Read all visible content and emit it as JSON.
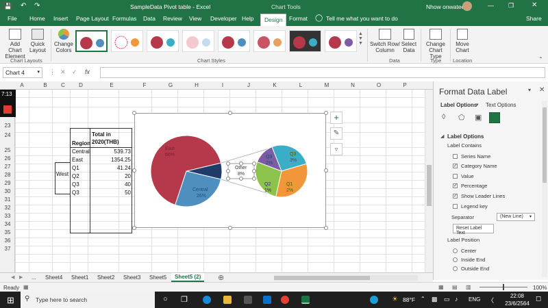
{
  "title_bar": {
    "title": "SampleData Pivot table  -  Excel",
    "context_tab": "Chart Tools",
    "user": "Nhow onwatee",
    "autosave_icon": "save-icon",
    "undo_icon": "undo-icon",
    "redo_icon": "redo-icon"
  },
  "tabs": [
    {
      "label": "File"
    },
    {
      "label": "Home"
    },
    {
      "label": "Insert"
    },
    {
      "label": "Page Layout"
    },
    {
      "label": "Formulas"
    },
    {
      "label": "Data"
    },
    {
      "label": "Review"
    },
    {
      "label": "View"
    },
    {
      "label": "Developer"
    },
    {
      "label": "Help"
    },
    {
      "label": "Design"
    },
    {
      "label": "Format"
    }
  ],
  "tell_me": "Tell me what you want to do",
  "share": "Share",
  "ribbon": {
    "add_chart_element": "Add Chart Element",
    "quick_layout": "Quick Layout",
    "change_colors": "Change Colors",
    "chart_layouts": "Chart Layouts",
    "chart_styles": "Chart Styles",
    "switch_row_column": "Switch Row/ Column",
    "select_data": "Select Data",
    "data_group": "Data",
    "change_chart_type": "Change Chart Type",
    "type_group": "Type",
    "move_chart": "Move Chart",
    "location_group": "Location"
  },
  "name_box": "Chart 4",
  "fx": "fx",
  "columns": [
    "A",
    "B",
    "C",
    "D",
    "E",
    "F",
    "G",
    "H",
    "I",
    "J",
    "K",
    "L",
    "M",
    "N",
    "O",
    "P"
  ],
  "rows": [
    "20",
    "21",
    "22",
    "23",
    "24",
    "25",
    "26",
    "27",
    "28",
    "29",
    "30",
    "31",
    "32",
    "33",
    "34",
    "35",
    "36",
    "37"
  ],
  "timer": "7:13",
  "table": {
    "header_region": "Region",
    "header_total": "Total in 2020(THB)",
    "group_label": "West",
    "rows": [
      {
        "region": "Central",
        "value": "539.73"
      },
      {
        "region": "East",
        "value": "1354.25"
      },
      {
        "region": "Q1",
        "value": "41.24"
      },
      {
        "region": "Q2",
        "value": "20"
      },
      {
        "region": "Q3",
        "value": "40"
      },
      {
        "region": "Q3",
        "value": "50"
      }
    ]
  },
  "chart_data": {
    "type": "pie",
    "subtype": "pie-of-pie",
    "main_pie": [
      {
        "label": "East",
        "value": 1354.25,
        "pct": "66%",
        "color": "#b5394a"
      },
      {
        "label": "Central",
        "value": 539.73,
        "pct": "26%",
        "color": "#4f8fc0"
      },
      {
        "label": "Other",
        "value": 151.24,
        "pct": "8%",
        "color": "#1f3c68"
      }
    ],
    "secondary_pie": [
      {
        "label": "Q3",
        "value": 40,
        "pct": "2%",
        "color": "#3aaec6"
      },
      {
        "label": "Q3",
        "value": 50,
        "pct": "3%",
        "color": "#f2963a"
      },
      {
        "label": "Q1",
        "value": 41.24,
        "pct": "2%",
        "color": "#8cc34a"
      },
      {
        "label": "Q2",
        "value": 20,
        "pct": "1%",
        "color": "#7d5ba6"
      }
    ],
    "label_east": "East",
    "label_east_pct": "66%",
    "label_central": "Central",
    "label_central_pct": "26%",
    "label_other": "Other",
    "label_other_pct": "8%",
    "label_q3a": "Q3",
    "label_q3a_pct": "2%",
    "label_q3b": "Q3",
    "label_q3b_pct": "3%",
    "label_q1": "Q1",
    "label_q1_pct": "2%",
    "label_q2": "Q2",
    "label_q2_pct": "1%"
  },
  "pane": {
    "title": "Format Data Label",
    "tab_label_options": "Label Options",
    "tab_text_options": "Text Options",
    "section": "Label Options",
    "label_contains": "Label Contains",
    "options": [
      {
        "label": "Series Name",
        "checked": false
      },
      {
        "label": "Category Name",
        "checked": true
      },
      {
        "label": "Value",
        "checked": false
      },
      {
        "label": "Percentage",
        "checked": true
      },
      {
        "label": "Show Leader Lines",
        "checked": true
      },
      {
        "label": "Legend key",
        "checked": false
      }
    ],
    "separator_label": "Separator",
    "separator_value": "(New Line)",
    "reset_button": "Reset Label Text",
    "label_position": "Label Position",
    "positions": [
      {
        "label": "Center"
      },
      {
        "label": "Inside End"
      },
      {
        "label": "Outside End"
      }
    ]
  },
  "sheets": [
    {
      "label": "..."
    },
    {
      "label": "Sheet4"
    },
    {
      "label": "Sheet1"
    },
    {
      "label": "Sheet2"
    },
    {
      "label": "Sheet3"
    },
    {
      "label": "Sheet5"
    },
    {
      "label": "Sheet5 (2)"
    }
  ],
  "status": {
    "ready": "Ready",
    "zoom": "100%"
  },
  "taskbar": {
    "search_placeholder": "Type here to search",
    "temperature": "88°F",
    "lang": "ENG",
    "time": "22:08",
    "date": "23/6/2564"
  }
}
